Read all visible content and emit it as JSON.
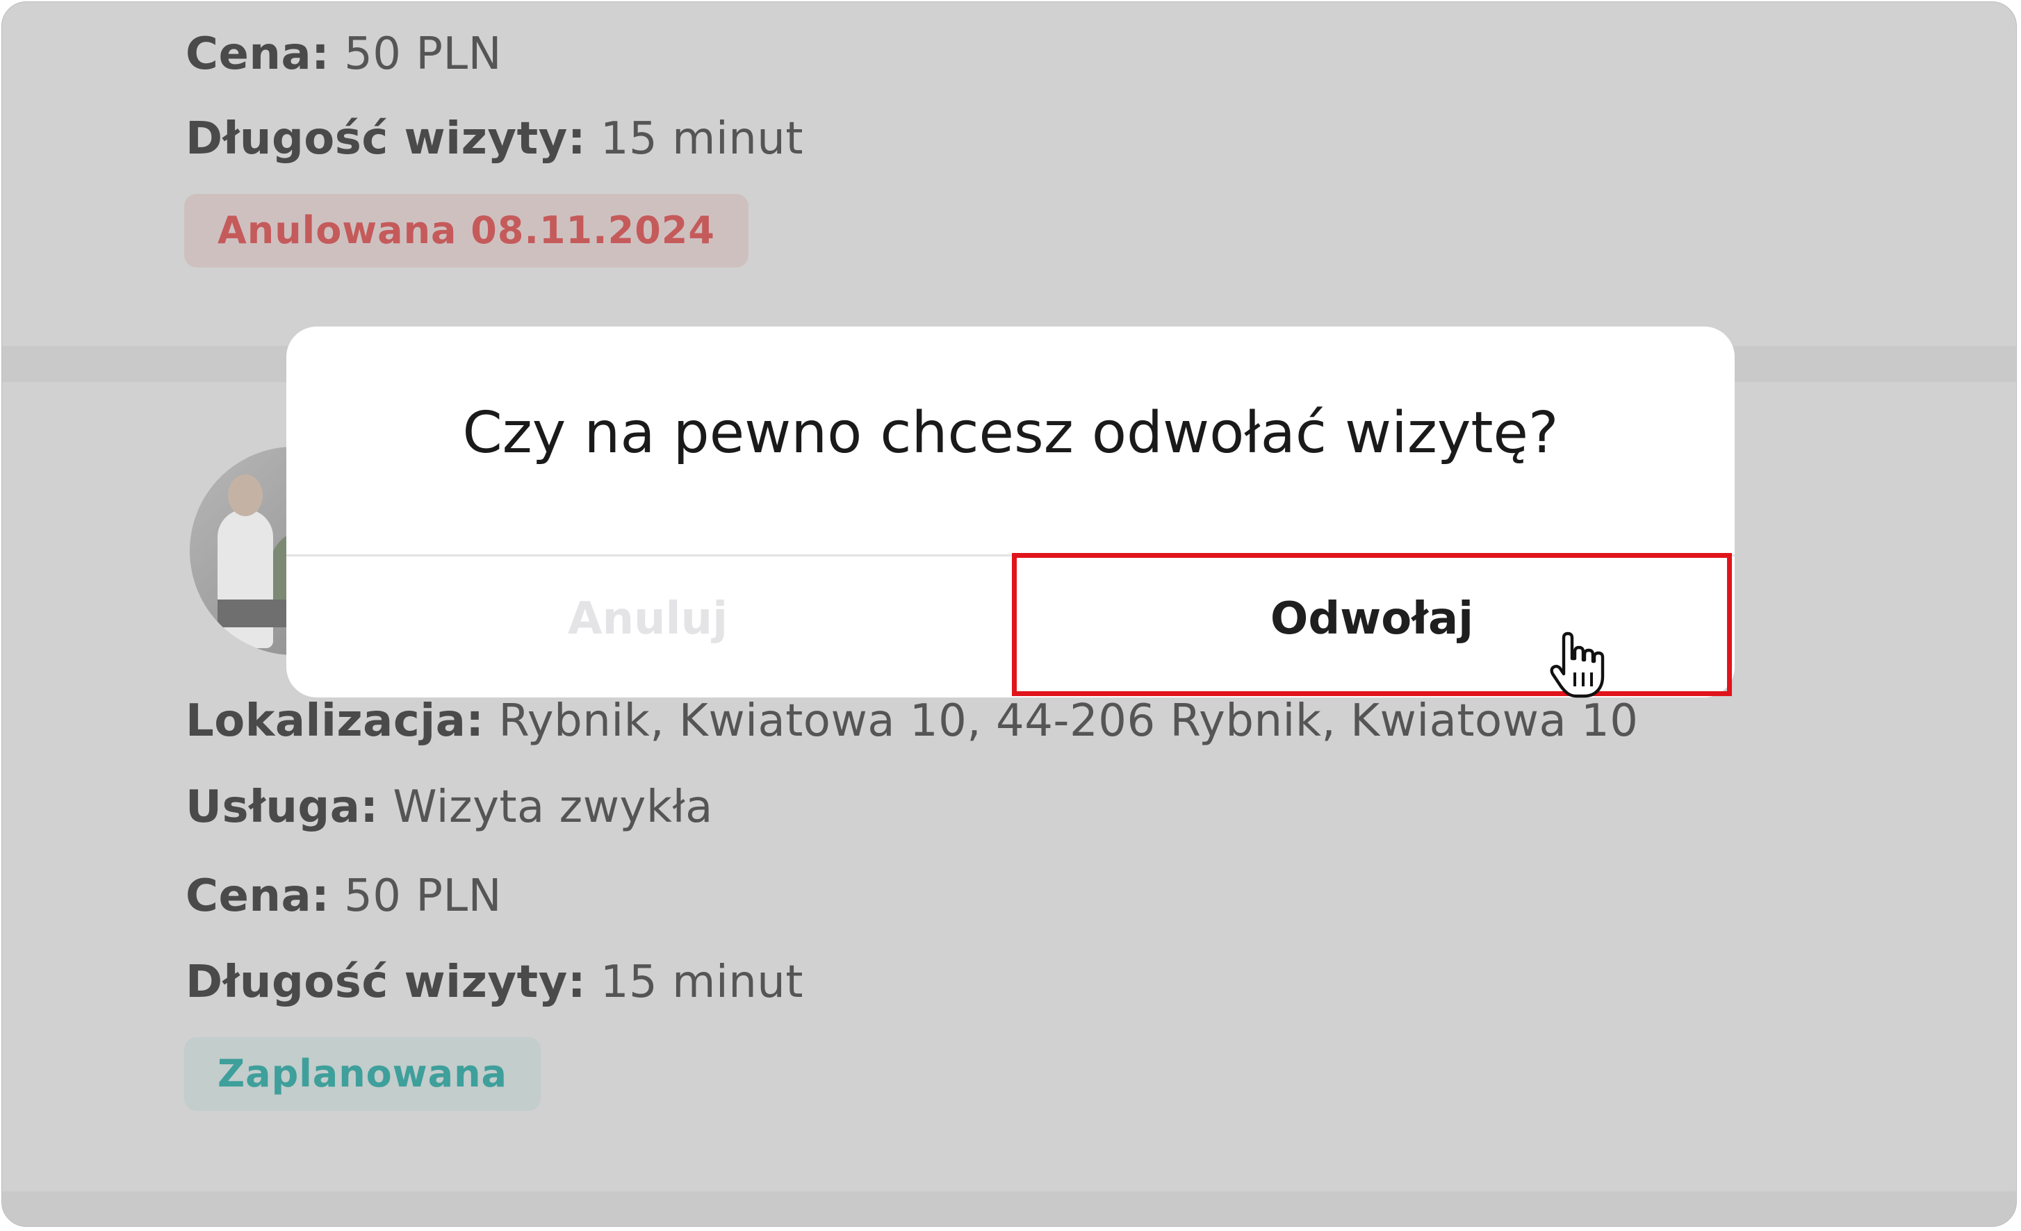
{
  "appointment_1": {
    "price_label": "Cena:",
    "price_value": "50 PLN",
    "duration_label": "Długość wizyty:",
    "duration_value": "15 minut",
    "status": "Anulowana 08.11.2024",
    "status_color": "#c55a5a"
  },
  "appointment_2": {
    "location_label": "Lokalizacja:",
    "location_value": "Rybnik, Kwiatowa 10, 44-206 Rybnik, Kwiatowa 10",
    "service_label": "Usługa:",
    "service_value": "Wizyta zwykła",
    "price_label": "Cena:",
    "price_value": "50 PLN",
    "duration_label": "Długość wizyty:",
    "duration_value": "15 minut",
    "status": "Zaplanowana",
    "status_color": "#3e9f9b"
  },
  "dialog": {
    "question": "Czy na pewno chcesz odwołać wizytę?",
    "cancel_label": "Anuluj",
    "confirm_label": "Odwołaj",
    "highlight_color": "#e0141b"
  },
  "icons": {
    "cursor": "hand-pointer-icon"
  }
}
